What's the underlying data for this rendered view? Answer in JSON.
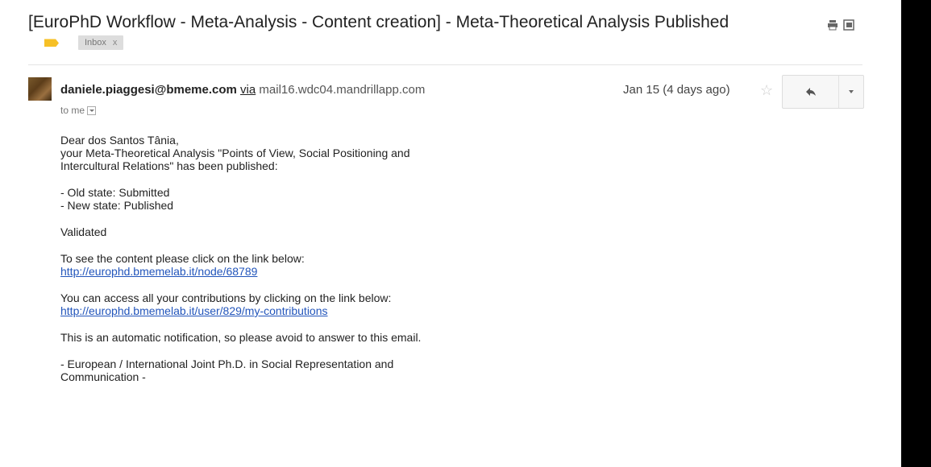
{
  "subject": {
    "text": "[EuroPhD Workflow - Meta-Analysis - Content creation] - Meta-Theoretical Analysis Published",
    "label_chip": "Inbox",
    "label_chip_close": "x"
  },
  "message": {
    "sender": "daniele.piaggesi@bmeme.com",
    "via_label": "via",
    "via_host": "mail16.wdc04.mandrillapp.com",
    "to": "to me",
    "date": "Jan 15 (4 days ago)",
    "body": {
      "greeting": "Dear dos Santos Tânia,",
      "line1": "your Meta-Theoretical Analysis \"Points of View, Social Positioning and",
      "line2": "Intercultural Relations\" has been published:",
      "old_state": "- Old state: Submitted",
      "new_state": "- New state: Published",
      "validated": "Validated",
      "see_content": "To see the content please click on the link below:",
      "content_link": "http://europhd.bmemelab.it/node/68789",
      "contributions": "You can access all your contributions by clicking on the link below:",
      "contributions_link": "http://europhd.bmemelab.it/user/829/my-contributions",
      "automatic": "This is an automatic notification, so please avoid to answer to this email.",
      "signature1": "- European / International Joint Ph.D. in Social Representation and",
      "signature2": "Communication -"
    }
  },
  "colors": {
    "label_tag": "#f6c026",
    "link": "#2255bb",
    "background_right": "#000000"
  },
  "icons": [
    "print-icon",
    "popout-icon",
    "label-tag-icon",
    "star-icon",
    "reply-icon",
    "more-options-icon",
    "to-details-icon"
  ]
}
